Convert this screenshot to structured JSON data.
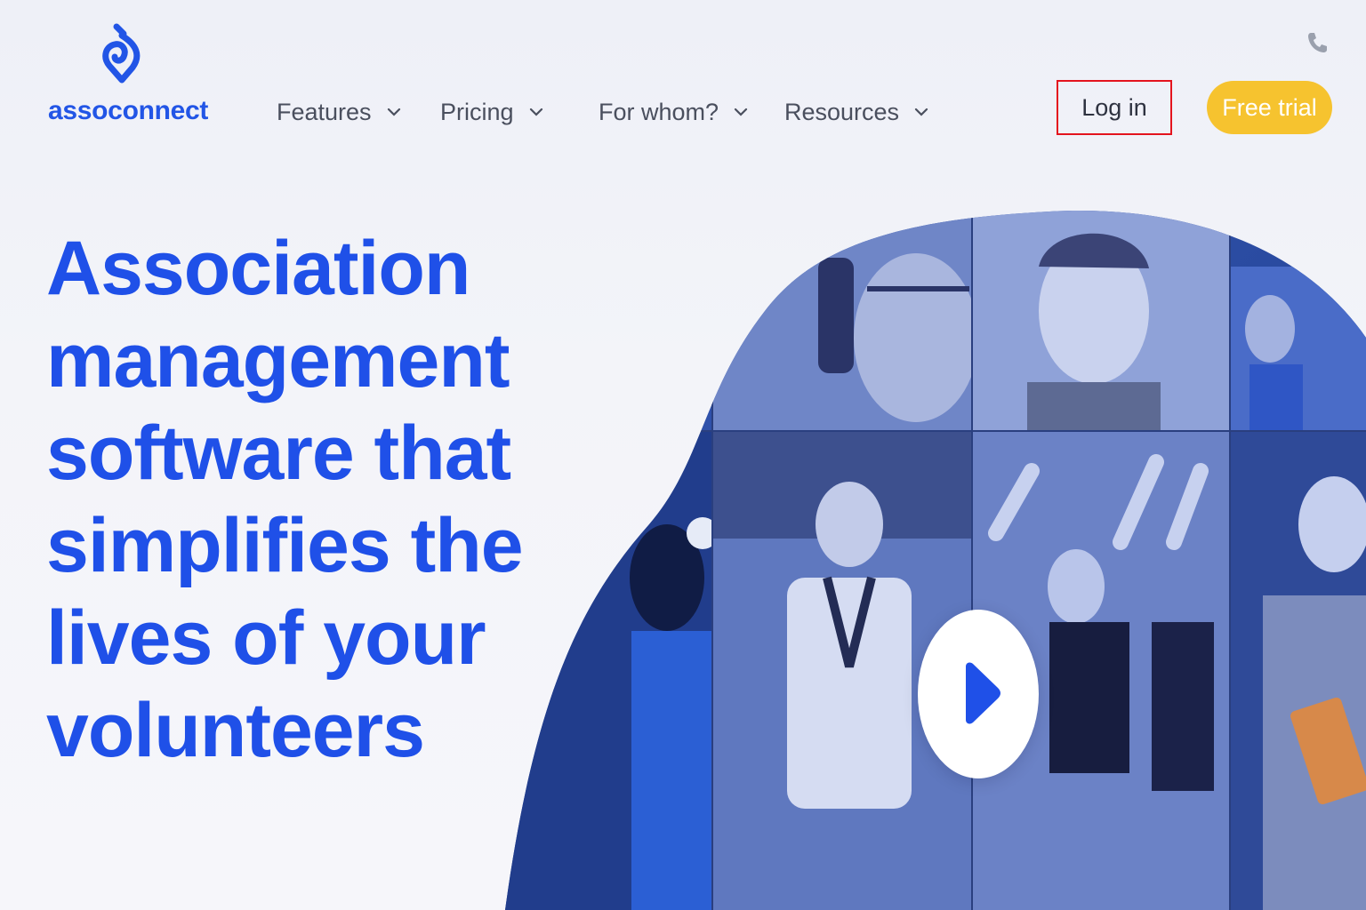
{
  "brand": {
    "name": "assoconnect",
    "accent": "#2255e6"
  },
  "nav": {
    "items": [
      {
        "label": "Features"
      },
      {
        "label": "Pricing"
      },
      {
        "label": "For whom?"
      },
      {
        "label": "Resources"
      }
    ]
  },
  "header": {
    "phone_icon": "phone-icon",
    "login_label": "Log in",
    "trial_label": "Free trial",
    "trial_color": "#f6c32f",
    "highlight_color": "#e4141e"
  },
  "hero": {
    "headline": "Association management software that simplifies the lives of your volunteers",
    "play_icon": "play-icon"
  }
}
